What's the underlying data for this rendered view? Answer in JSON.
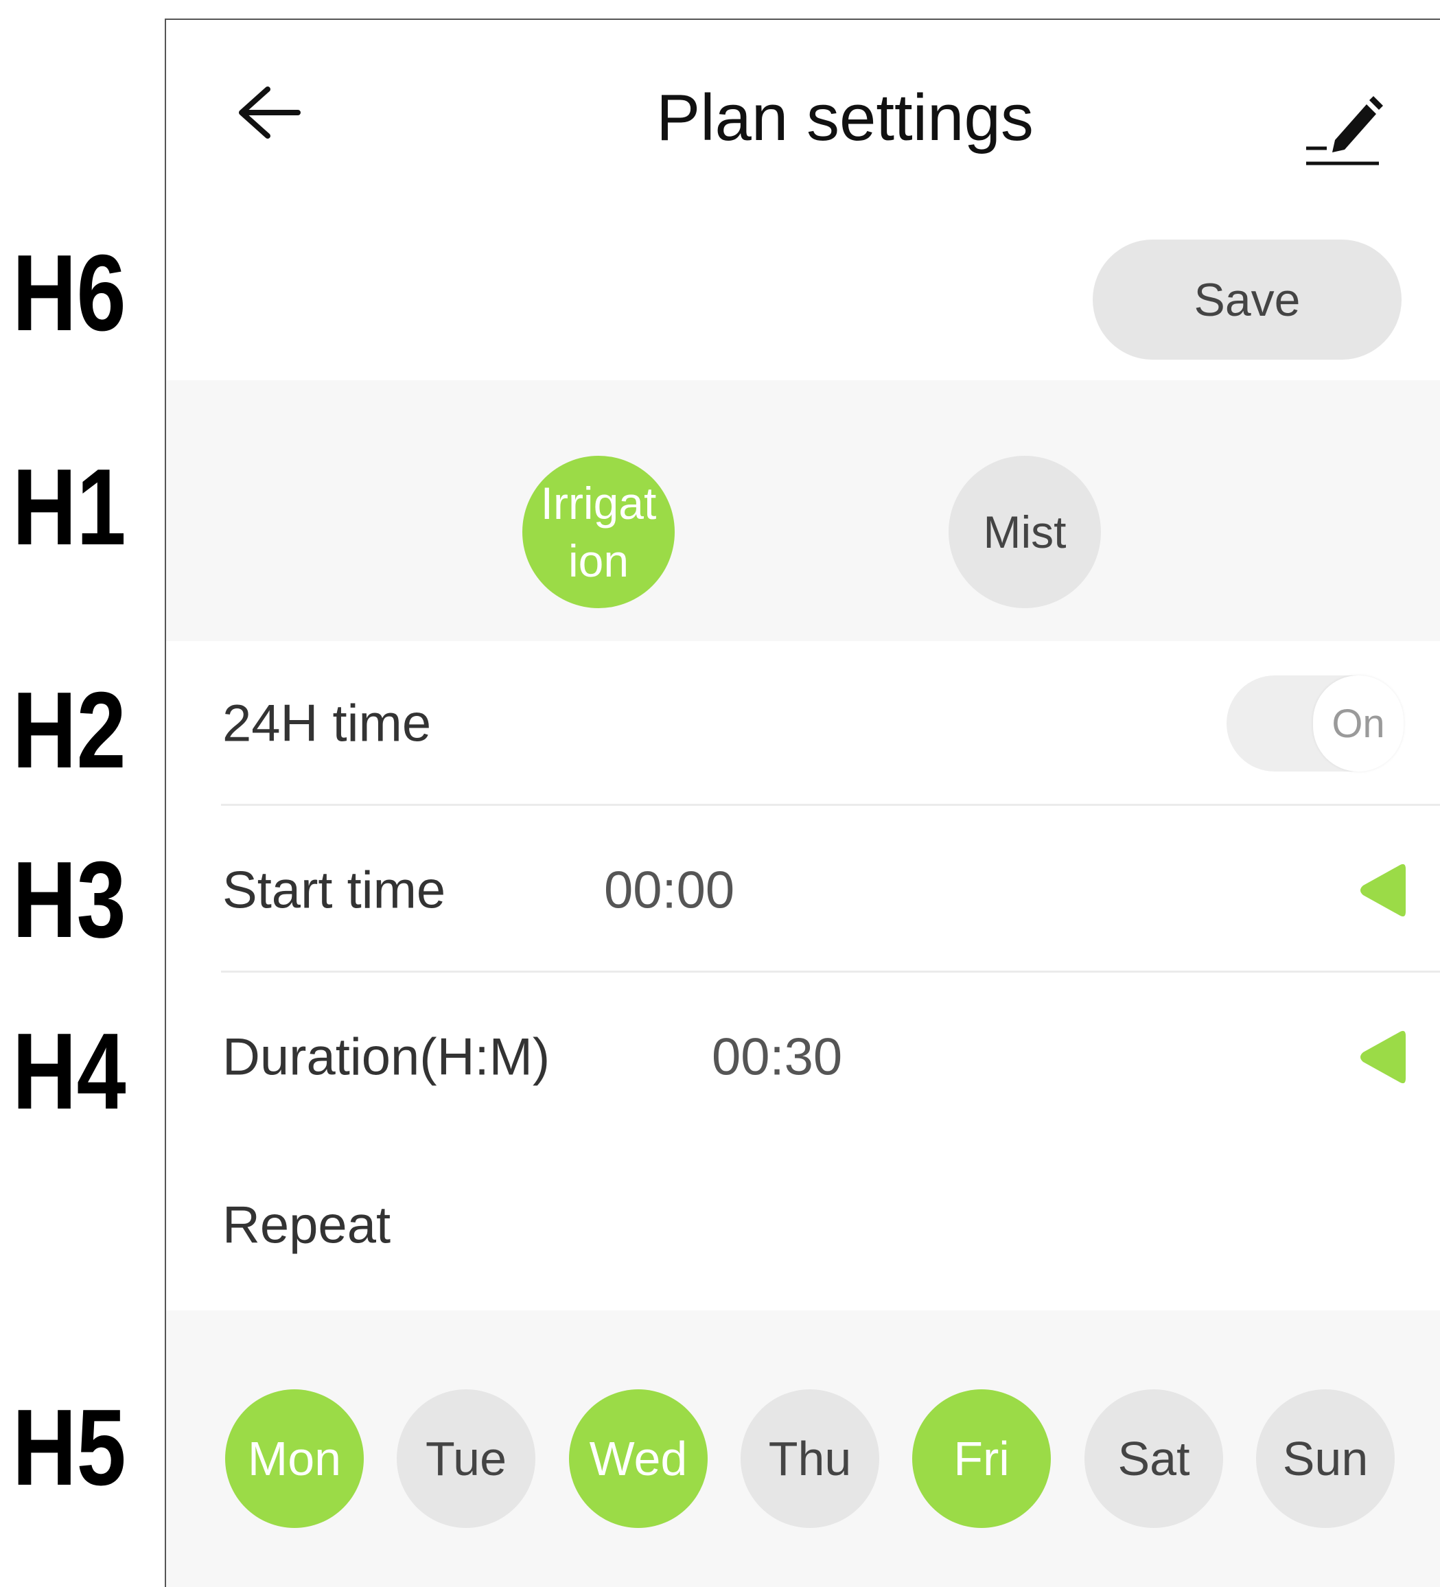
{
  "callouts": {
    "h6": "H6",
    "h1": "H1",
    "h2": "H2",
    "h3": "H3",
    "h4": "H4",
    "h5": "H5"
  },
  "header": {
    "title": "Plan settings",
    "back_icon": "arrow-left-icon",
    "edit_icon": "pencil-icon"
  },
  "save_label": "Save",
  "modes": [
    {
      "label": "Irrigation",
      "active": true
    },
    {
      "label": "Mist",
      "active": false
    }
  ],
  "time_format": {
    "label": "24H time",
    "toggle_text": "On"
  },
  "start_time": {
    "label": "Start time",
    "value": "00:00"
  },
  "duration": {
    "label": "Duration(H:M)",
    "value": "00:30"
  },
  "repeat": {
    "label": "Repeat",
    "days": [
      {
        "label": "Mon",
        "active": true
      },
      {
        "label": "Tue",
        "active": false
      },
      {
        "label": "Wed",
        "active": true
      },
      {
        "label": "Thu",
        "active": false
      },
      {
        "label": "Fri",
        "active": true
      },
      {
        "label": "Sat",
        "active": false
      },
      {
        "label": "Sun",
        "active": false
      }
    ]
  },
  "colors": {
    "accent_green": "#9bdb47",
    "inactive_grey": "#e6e6e6",
    "panel_bg": "#f7f7f7"
  }
}
